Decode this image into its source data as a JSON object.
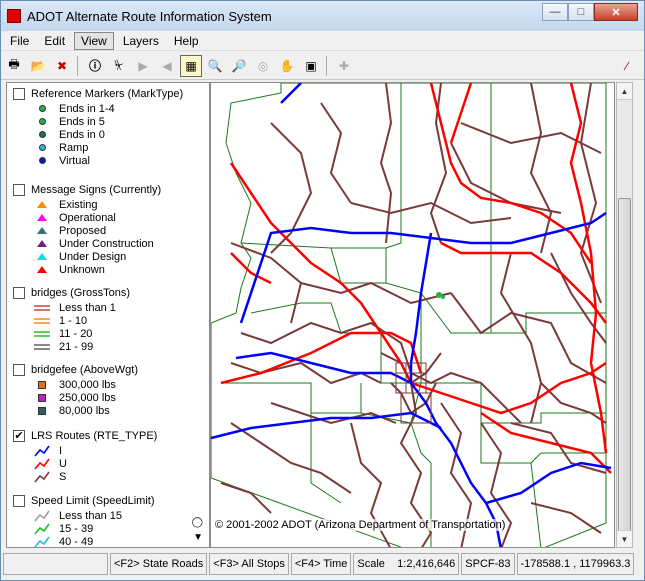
{
  "window": {
    "title": "ADOT Alternate Route Information System"
  },
  "menu": {
    "items": [
      "File",
      "Edit",
      "View",
      "Layers",
      "Help"
    ],
    "active": "View"
  },
  "toolbar": {
    "buttons": [
      "print-icon",
      "open-icon",
      "erase-icon",
      "info-icon",
      "export-icon",
      "forward-icon",
      "back-icon",
      "layer-icon",
      "zoom-in-icon",
      "zoom-out-icon",
      "zoom-center-icon",
      "pan-icon",
      "zoom-extent-icon",
      "measure-icon",
      "refresh-icon"
    ],
    "selected": "layer-icon"
  },
  "legend": {
    "layers": [
      {
        "name": "Reference Markers (MarkType)",
        "checked": false,
        "entries": [
          {
            "label": "Ends in 1-4",
            "shape": "dot",
            "color": "#22b24c"
          },
          {
            "label": "Ends in 5",
            "shape": "dot",
            "color": "#22b24c"
          },
          {
            "label": "Ends in 0",
            "shape": "dot",
            "color": "#127a2e"
          },
          {
            "label": "Ramp",
            "shape": "dot",
            "color": "#28b8c8"
          },
          {
            "label": "Virtual",
            "shape": "dot",
            "color": "#1010c0"
          }
        ]
      },
      {
        "name": "Message Signs (Currently)",
        "checked": false,
        "entries": [
          {
            "label": "Existing",
            "shape": "tri",
            "color": "#ff8c00"
          },
          {
            "label": "Operational",
            "shape": "tri",
            "color": "#ff00ff"
          },
          {
            "label": "Proposed",
            "shape": "tri",
            "color": "#3c6e78"
          },
          {
            "label": "Under Construction",
            "shape": "tri",
            "color": "#7a1a7a"
          },
          {
            "label": "Under Design",
            "shape": "tri",
            "color": "#00e0e0"
          },
          {
            "label": "Unknown",
            "shape": "tri",
            "color": "#ff0000"
          }
        ]
      },
      {
        "name": "bridges (GrossTons)",
        "checked": false,
        "entries": [
          {
            "label": "Less than 1",
            "shape": "dline",
            "color": "#d04040"
          },
          {
            "label": "1 - 10",
            "shape": "dline",
            "color": "#ff8c00"
          },
          {
            "label": "11 - 20",
            "shape": "dline",
            "color": "#20c020"
          },
          {
            "label": "21 - 99",
            "shape": "dline",
            "color": "#606060"
          }
        ]
      },
      {
        "name": "bridgefee (AboveWgt)",
        "checked": false,
        "entries": [
          {
            "label": "300,000 lbs",
            "shape": "sq",
            "color": "#e07020"
          },
          {
            "label": "250,000 lbs",
            "shape": "sq",
            "color": "#c020c0"
          },
          {
            "label": "80,000 lbs",
            "shape": "sq",
            "color": "#306060"
          }
        ]
      },
      {
        "name": "LRS Routes (RTE_TYPE)",
        "checked": true,
        "entries": [
          {
            "label": "I",
            "shape": "zig",
            "color": "#0000ff"
          },
          {
            "label": "U",
            "shape": "zig",
            "color": "#ff0000"
          },
          {
            "label": "S",
            "shape": "zig",
            "color": "#7a3a3a"
          }
        ]
      },
      {
        "name": "Speed Limit (SpeedLimit)",
        "checked": false,
        "entries": [
          {
            "label": "Less than 15",
            "shape": "zig",
            "color": "#a0a0a0"
          },
          {
            "label": "15 - 39",
            "shape": "zig",
            "color": "#20c020"
          },
          {
            "label": "40 - 49",
            "shape": "zig",
            "color": "#20c0e0"
          }
        ]
      }
    ]
  },
  "map": {
    "copyright": "© 2001-2002 ADOT (Arizona Department of Transportation)",
    "colors": {
      "interstate": "#0000ff",
      "us_route": "#ff0000",
      "state_route": "#7a3a3a",
      "boundary": "#1a7a1a"
    }
  },
  "status": {
    "f2": "<F2> State Roads",
    "f3": "<F3> All Stops",
    "f4": "<F4> Time",
    "scale": "Scale    1:2,416,646",
    "proj": "SPCF-83",
    "coords": "-178588.1 , 1179963.3"
  }
}
